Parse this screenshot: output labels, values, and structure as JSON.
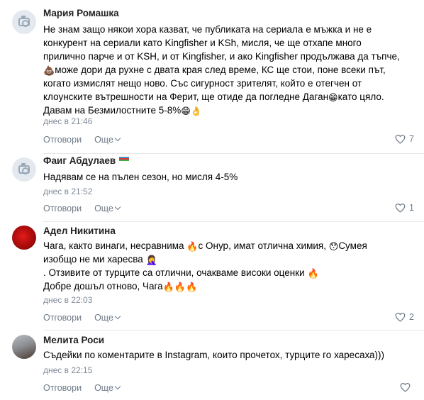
{
  "labels": {
    "reply": "Отговори",
    "more": "Още"
  },
  "colors": {
    "secondary_text": "#818c99",
    "action_text": "#6e7a88",
    "divider": "#e7e8ec"
  },
  "comments": [
    {
      "author": "Мария Ромашка",
      "avatar": "placeholder-camera-icon",
      "lines": [
        "Не знам защо някои хора казват, че публиката на сериала е мъжка и не е",
        "конкурент на сериали като Kingfisher и KSh, мисля, че ще отхапе много",
        "прилично парче и от KSH, и от Kingfisher, и ако Kingfisher продължава да тъпче,",
        "може дори да рухне с двата края след време, КС ще стои, поне всеки път,",
        "когато измислят нещо ново. Със сигурност зрителят, който е отегчен от",
        "клоунските вътрешности на Ферит, ще отиде да погледне Даган",
        "като цяло.",
        "Давам на Безмилостните 5-8%"
      ],
      "date": "днес в 21:46",
      "likes": "7"
    },
    {
      "author": "Фаиг Абдулаев",
      "avatar": "placeholder-camera-icon",
      "lines": [
        "Надявам се на пълен сезон, но мисля 4-5%"
      ],
      "date": "днес в 21:52",
      "likes": "1"
    },
    {
      "author": "Адел Никитина",
      "avatar": "red-rose-photo",
      "lines": [
        "Чага, както винаги, несравнима",
        "с Онур, имат отлична химия,",
        "Сумея",
        "изобщо не ми харесва",
        ". Отзивите от турците са отлични, очакваме високи оценки",
        "Добре дошъл отново, Чага"
      ],
      "date": "днес в 22:03",
      "likes": "2"
    },
    {
      "author": "Мелита Роси",
      "avatar": "person-photo",
      "lines": [
        "Съдейки по коментарите в Instagram, които прочетох, турците го харесаха)))"
      ],
      "date": "днес в 22:15",
      "likes": ""
    }
  ]
}
